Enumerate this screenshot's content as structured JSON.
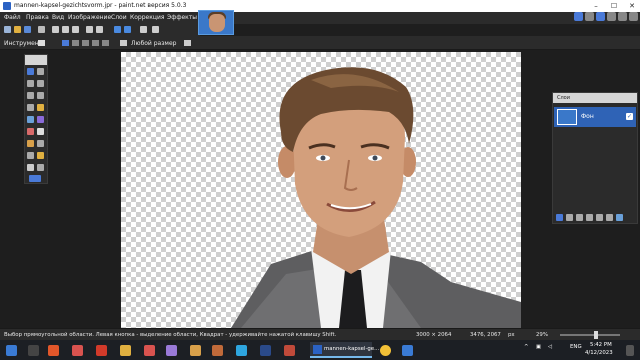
{
  "window": {
    "title": "mannen-kapsel-gezichtsvorm.jpr - paint.net версия 5.0.3"
  },
  "menubar": {
    "items": [
      "Файл",
      "Правка",
      "Вид",
      "Изображение",
      "Слои",
      "Коррекция",
      "Эффекты"
    ]
  },
  "options_bar": {
    "tool_label": "Инструмент:",
    "size_label": "Любой размер"
  },
  "tools_panel": {
    "header": ""
  },
  "layers_panel": {
    "title": "Слои",
    "layers": [
      {
        "name": "Фон",
        "visible": true
      }
    ]
  },
  "status_bar": {
    "hint": "Выбор прямоугольной области. Левая кнопка - выделение области, Квадрат - удерживайте нажатой клавишу Shift.",
    "image_size": "3000 × 2064",
    "cursor_pos": "3476, 2067",
    "unit": "px",
    "zoom": "29%"
  },
  "taskbar": {
    "active_app_label": "mannen-kapsel-ge...",
    "language": "ENG",
    "time": "5:42 PM",
    "date": "4/12/2023"
  },
  "colors": {
    "accent": "#2f63b6",
    "panel_bg": "#2b2b2b",
    "workspace_bg": "#1e1e1e"
  }
}
